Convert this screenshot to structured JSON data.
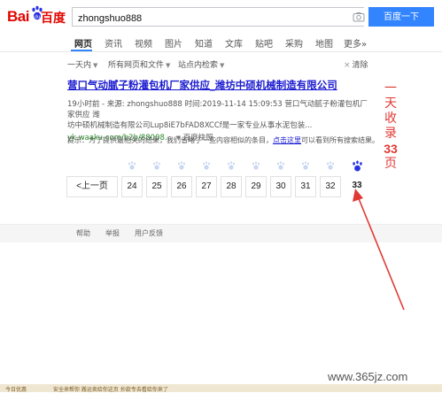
{
  "header": {
    "logo_bai": "Bai",
    "logo_du": "百度",
    "query": "zhongshuo888",
    "search_button": "百度一下"
  },
  "tabs": [
    {
      "label": "网页",
      "active": true
    },
    {
      "label": "资讯"
    },
    {
      "label": "视频"
    },
    {
      "label": "图片"
    },
    {
      "label": "知道"
    },
    {
      "label": "文库"
    },
    {
      "label": "贴吧"
    },
    {
      "label": "采购"
    },
    {
      "label": "地图"
    },
    {
      "label": "更多»"
    }
  ],
  "filters": {
    "time": "一天内",
    "type": "所有网页和文件",
    "site": "站点内检索",
    "clear": "清除"
  },
  "result": {
    "title": "营口气动腻子粉灌包机厂家供应_潍坊中硕机械制造有限公司",
    "meta_line1": "19小时前 - 来源: zhongshuo888 时间:2019-11-14 15:09:53 营口气动腻子粉灌包机厂家供应 潍",
    "meta_line2": "坊中硕机械制造有限公司Lup8iE7bFAD8XCCf是一家专业从事水泥包装...",
    "url": "yk.waaku.com/b2b/88008...",
    "snapshot": "百度快照"
  },
  "tip": {
    "prefix": "提示：为了提供最相关的结果，我们省略了一些内容相似的条目，",
    "link": "点击这里",
    "suffix": "可以看到所有搜索结果。"
  },
  "pagination": {
    "prev": "<上一页",
    "pages": [
      "24",
      "25",
      "26",
      "27",
      "28",
      "29",
      "30",
      "31",
      "32",
      "33"
    ],
    "current": "33"
  },
  "footer": {
    "help": "帮助",
    "report": "举报",
    "feedback": "用户反馈"
  },
  "annotation": {
    "l1": "一",
    "l2": "天",
    "l3": "收",
    "l4": "录",
    "num": "33",
    "l5": "页"
  },
  "watermark": "www.365jz.com",
  "bottom_strip": {
    "left": "今日优惠",
    "right": "安全来帮你 搬运卖给你这页 抄款专去看给你来了"
  },
  "colors": {
    "brand_red": "#e10601",
    "accent_blue": "#3385ff",
    "link_blue": "#1b1bd0",
    "url_green": "#2b8a2b",
    "annotation_red": "#e03a35"
  }
}
